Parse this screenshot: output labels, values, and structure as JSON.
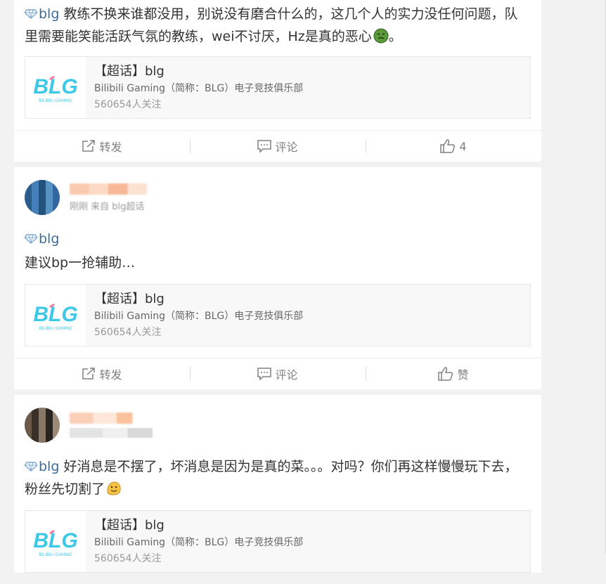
{
  "posts": [
    {
      "tag": "blg",
      "text": " 教练不换来谁都没用，别说没有磨合什么的，这几个人的实力没任何问题，队里需要能笑能活跃气氛的教练，wei不讨厌，Hz是真的恶心",
      "text_end": "。",
      "emoji": "sick-face-emoji",
      "card": {
        "title": "【超话】blg",
        "desc": "Bilibili Gaming（简称：BLG）电子竞技俱乐部",
        "fans": "560654人关注"
      },
      "actions": {
        "repost": "转发",
        "comment": "评论",
        "like": "4"
      }
    },
    {
      "username": "",
      "source": "刚刚 来自 blg超话",
      "tag": "blg",
      "text": "建议bp一抢辅助…",
      "card": {
        "title": "【超话】blg",
        "desc": "Bilibili Gaming（简称：BLG）电子竞技俱乐部",
        "fans": "560654人关注"
      },
      "actions": {
        "repost": "转发",
        "comment": "评论",
        "like": "赞"
      }
    },
    {
      "username": "",
      "source": "",
      "tag": "blg",
      "text": " 好消息是不摆了，坏消息是因为是真的菜。。。对吗？你们再这样慢慢玩下去，粉丝先切割了",
      "emoji": "melting-face-emoji",
      "card": {
        "title": "【超话】blg",
        "desc": "Bilibili Gaming（简称：BLG）电子竞技俱乐部",
        "fans": "560654人关注"
      }
    }
  ],
  "logo": {
    "letters": "BLG",
    "subtitle": "BILIBILI GAMING",
    "brand_color": "#3cc8e6",
    "accent_color": "#f07aa0"
  },
  "colors": {
    "tag": "#3e6c99",
    "background": "#f2f2f2"
  }
}
